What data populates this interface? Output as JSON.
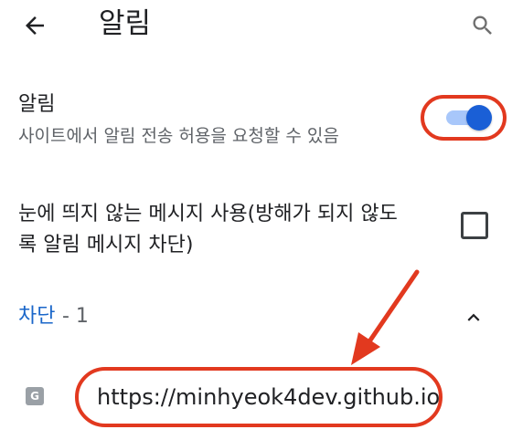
{
  "appbar": {
    "title": "알림",
    "back_icon": "arrow-left-icon",
    "search_icon": "search-icon"
  },
  "notifications": {
    "title": "알림",
    "summary": "사이트에서 알림 전송 허용을 요청할 수 있음",
    "enabled": true
  },
  "quiet_messages": {
    "label": "눈에 띄지 않는 메시지 사용(방해가 되지 않도록 알림 메시지 차단)",
    "checked": false
  },
  "blocked": {
    "label": "차단",
    "count_text": "- 1",
    "expanded": true
  },
  "sites": [
    {
      "favicon_letter": "G",
      "url": "https://minhyeok4dev.github.io"
    }
  ],
  "colors": {
    "accent_blue": "#1a5fd6",
    "link_blue": "#1a66c9",
    "annotation_red": "#e2391f",
    "text_primary": "#202124",
    "text_secondary": "#5f6368"
  }
}
